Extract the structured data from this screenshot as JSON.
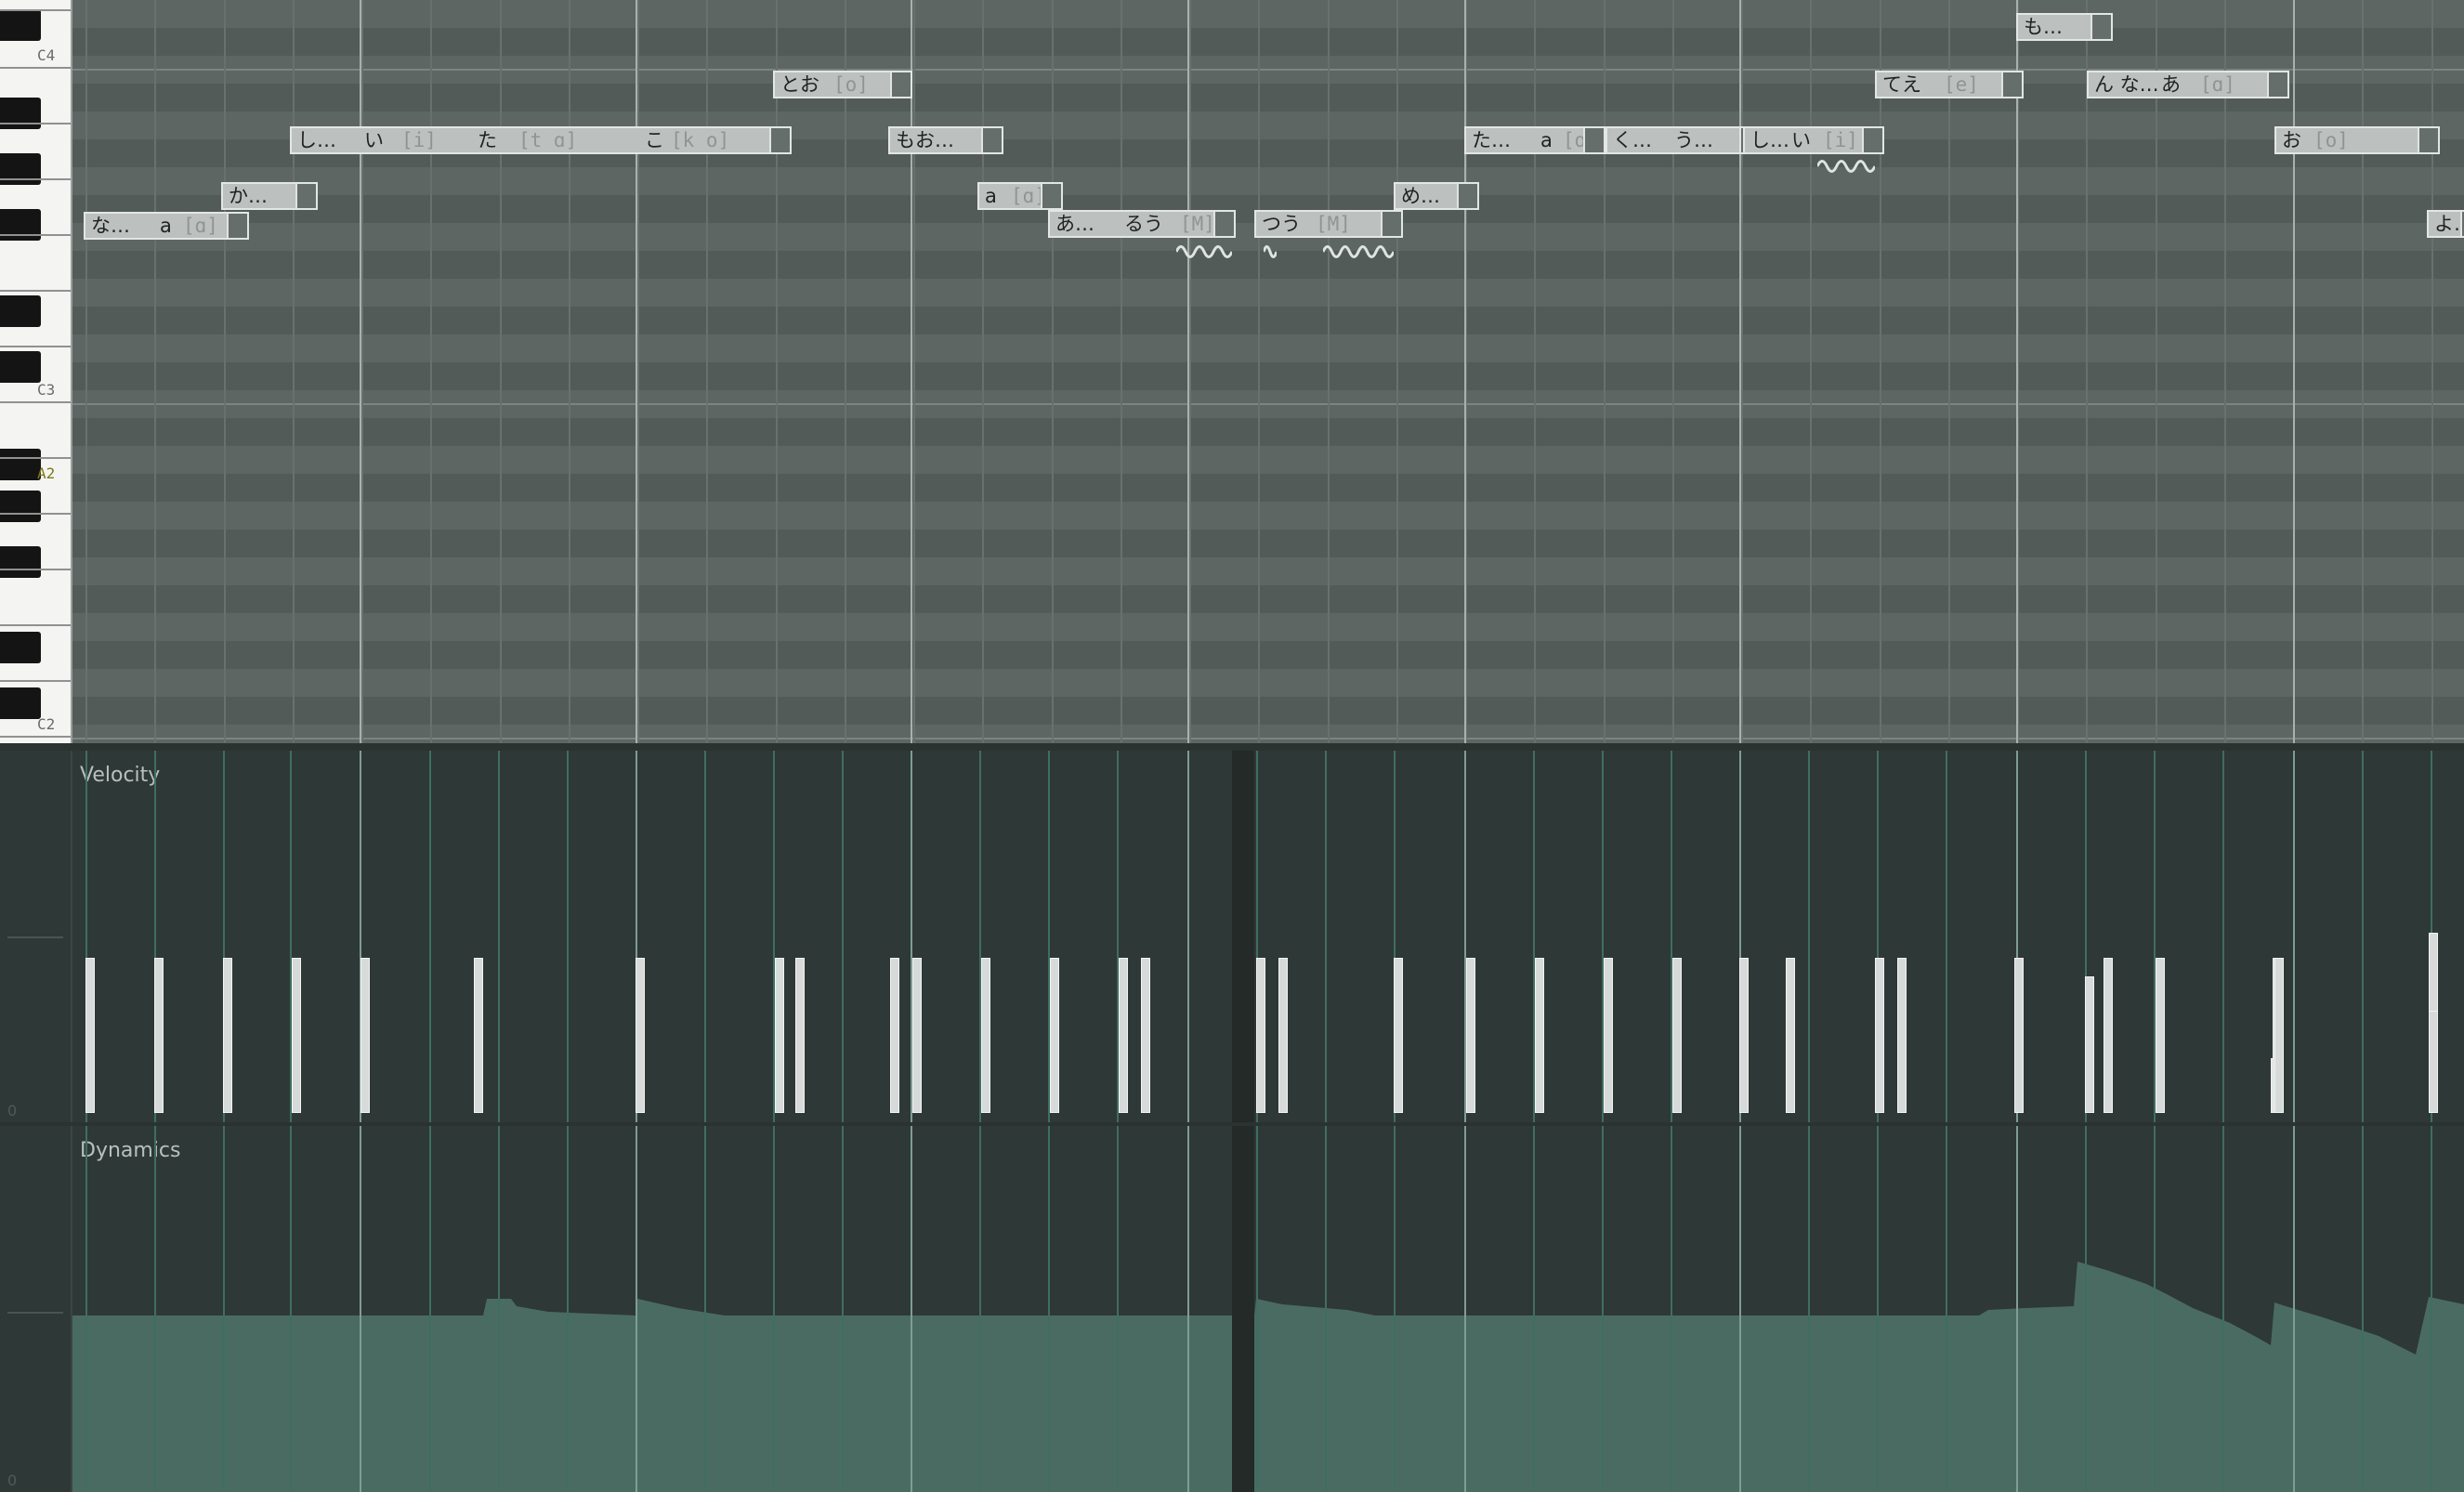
{
  "keyboard": {
    "labels": [
      "C4",
      "C3",
      "A2",
      "C2"
    ],
    "highlight": "A2"
  },
  "notes": [
    {
      "lyric": "な…",
      "extra": "a",
      "phon": "[ɑ]"
    },
    {
      "lyric": "か…",
      "extra": "",
      "phon": ""
    },
    {
      "lyric": "し…",
      "extra": "い",
      "phon": "[i]"
    },
    {
      "lyric": "た",
      "extra": "",
      "phon": "[t ɑ]"
    },
    {
      "lyric": "こ",
      "extra": "",
      "phon": "[k o]"
    },
    {
      "lyric": "とお",
      "extra": "",
      "phon": "[o]"
    },
    {
      "lyric": "もお…",
      "extra": "",
      "phon": ""
    },
    {
      "lyric": "a",
      "extra": "",
      "phon": "[ɑ]"
    },
    {
      "lyric": "あ…",
      "extra": "るう",
      "phon": "[M]"
    },
    {
      "lyric": "つう",
      "extra": "",
      "phon": "[M]"
    },
    {
      "lyric": "め…",
      "extra": "",
      "phon": ""
    },
    {
      "lyric": "た…",
      "extra": "a",
      "phon": "[ɑ]"
    },
    {
      "lyric": "く…",
      "extra": "う…",
      "phon": ""
    },
    {
      "lyric": "し…",
      "extra": "い",
      "phon": "[i]"
    },
    {
      "lyric": "てえ",
      "extra": "",
      "phon": "[e]"
    },
    {
      "lyric": "も…",
      "extra": "",
      "phon": ""
    },
    {
      "lyric": "ん な…",
      "extra": "あ",
      "phon": "[ɑ]"
    },
    {
      "lyric": "お",
      "extra": "",
      "phon": "[o]"
    },
    {
      "lyric": "よ…",
      "extra": "",
      "phon": ""
    }
  ],
  "lanes": {
    "velocity": {
      "title": "Velocity",
      "bottom_label": "0",
      "levels": [
        0.85,
        0.85,
        0.85,
        0.85,
        0.85,
        0.85,
        0.85,
        0.85,
        0.85,
        0.85,
        0.85,
        0.85,
        0.85,
        0.85,
        0.85,
        0.85,
        0.85,
        0.85,
        0.85,
        0.85,
        0.85,
        0.85,
        0.85,
        0.85,
        0.85,
        0.85,
        0.85,
        0.75,
        0.85,
        0.85,
        0.3,
        0.85,
        0.85,
        0.99,
        0.56
      ]
    },
    "dynamics": {
      "title": "Dynamics",
      "bottom_label": "0"
    }
  },
  "colors": {
    "grid_background": "#5c6461",
    "lane_background": "#2e3836",
    "note_fill": "#bcc1c0",
    "dynamics_fill": "#4a6b61",
    "accent_line": "#4f9a82"
  }
}
